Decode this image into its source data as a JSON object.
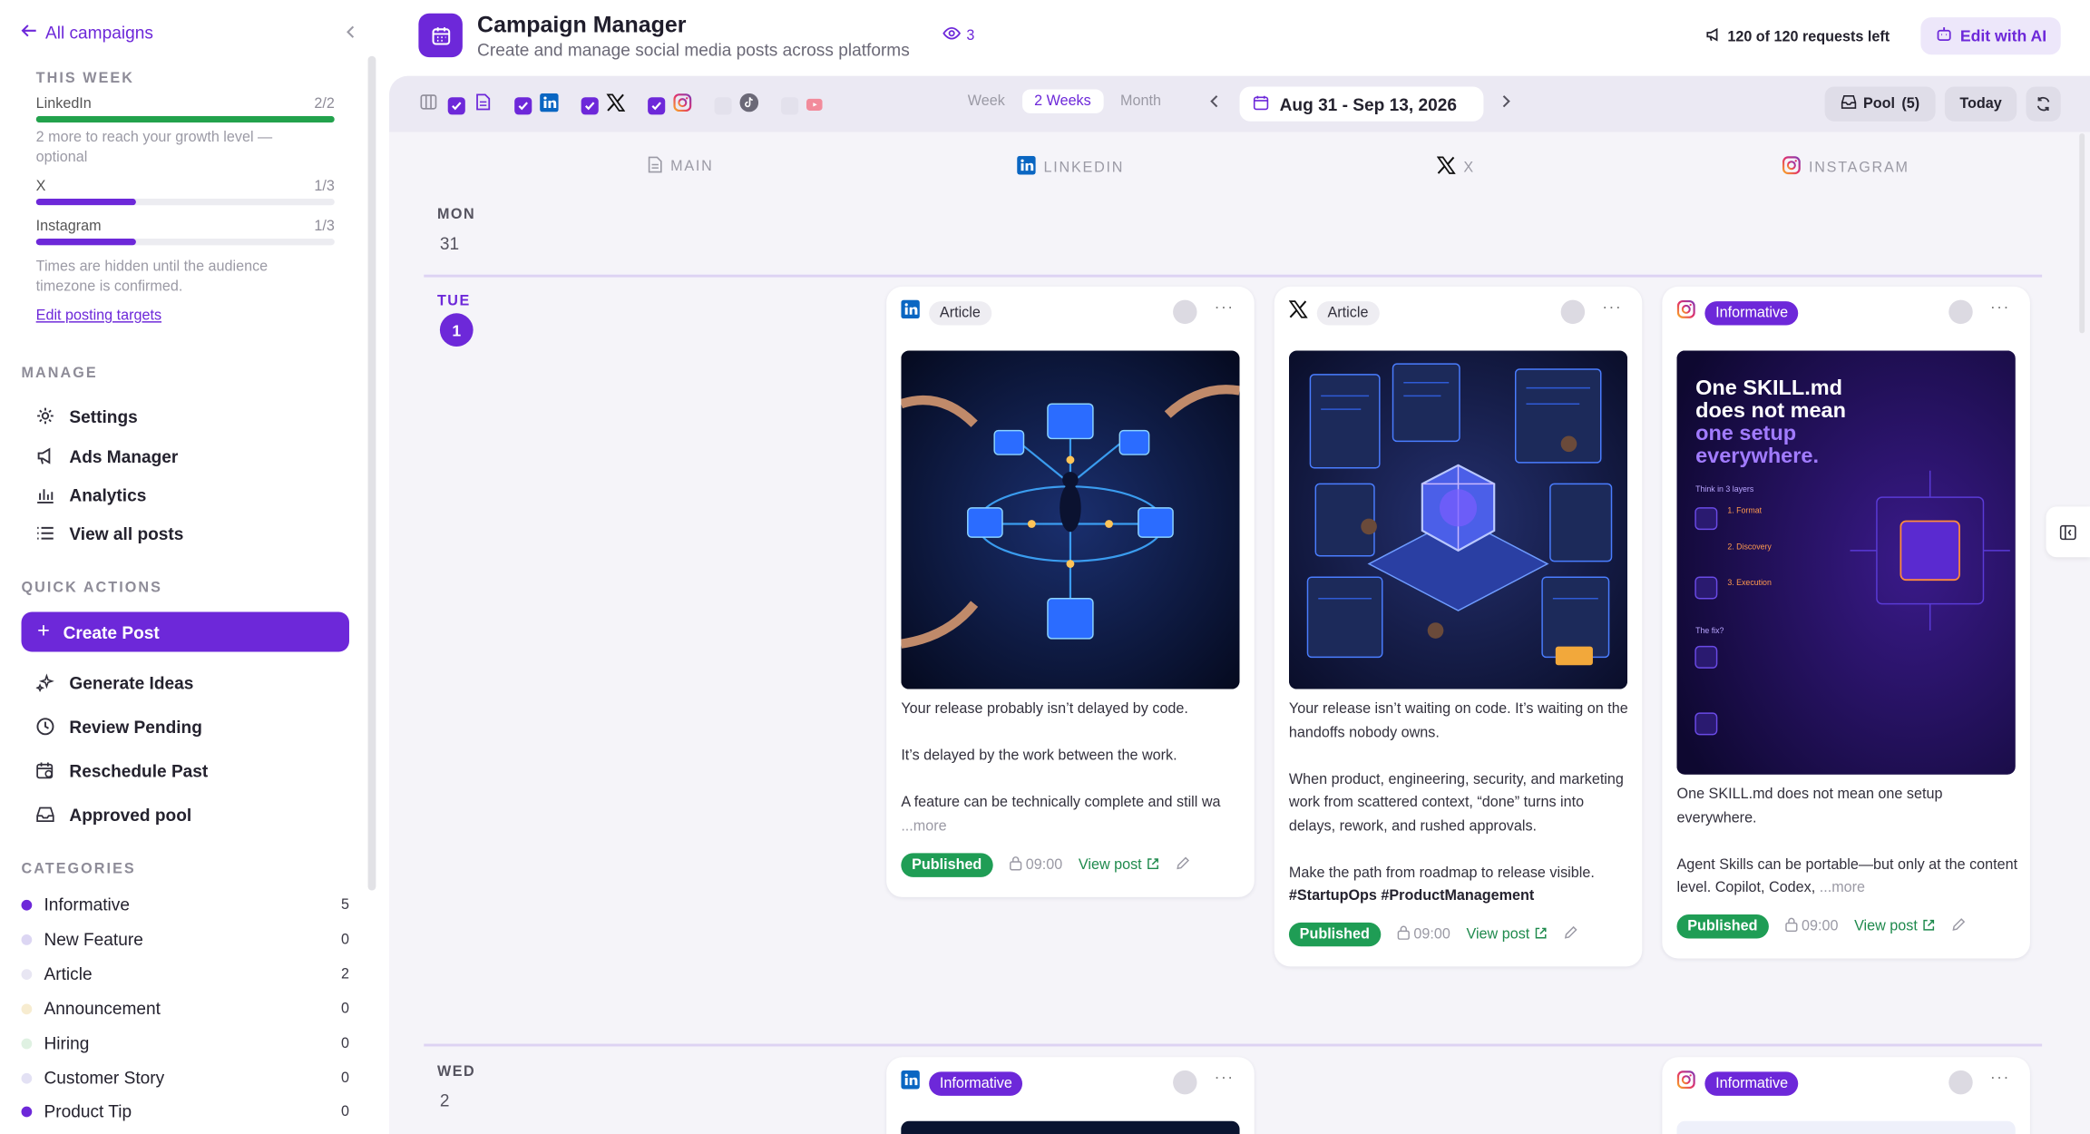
{
  "sidebar": {
    "back_label": "All campaigns",
    "this_week": {
      "title": "THIS WEEK",
      "targets": [
        {
          "name": "LinkedIn",
          "count": "2/2",
          "progress": 1.0,
          "color": "#22a24c"
        },
        {
          "name": "X",
          "count": "1/3",
          "progress": 0.333,
          "color": "#6d28d9"
        },
        {
          "name": "Instagram",
          "count": "1/3",
          "progress": 0.333,
          "color": "#6d28d9"
        }
      ],
      "linkedin_note": "2 more to reach your growth level — optional",
      "timezone_note": "Times are hidden until the audience timezone is confirmed.",
      "edit_link": "Edit posting targets"
    },
    "manage": {
      "title": "MANAGE",
      "items": [
        "Settings",
        "Ads Manager",
        "Analytics",
        "View all posts"
      ]
    },
    "quick_actions": {
      "title": "QUICK ACTIONS",
      "create": "Create Post",
      "items": [
        "Generate Ideas",
        "Review Pending",
        "Reschedule Past",
        "Approved pool"
      ]
    },
    "categories": {
      "title": "CATEGORIES",
      "items": [
        {
          "name": "Informative",
          "count": "5",
          "color": "#6d28d9"
        },
        {
          "name": "New Feature",
          "count": "0",
          "color": "#dcd6f3"
        },
        {
          "name": "Article",
          "count": "2",
          "color": "#e8e6f3"
        },
        {
          "name": "Announcement",
          "count": "0",
          "color": "#f7ecd0"
        },
        {
          "name": "Hiring",
          "count": "0",
          "color": "#dff1e2"
        },
        {
          "name": "Customer Story",
          "count": "0",
          "color": "#e3e1f4"
        },
        {
          "name": "Product Tip",
          "count": "0",
          "color": "#6d28d9"
        }
      ]
    }
  },
  "header": {
    "title": "Campaign Manager",
    "subtitle": "Create and manage social media posts across platforms",
    "views": "3",
    "requests": "120 of 120 requests left",
    "edit_ai": "Edit with AI"
  },
  "toolbar": {
    "views": [
      "Week",
      "2 Weeks",
      "Month"
    ],
    "active_view": "2 Weeks",
    "date_range": "Aug 31 - Sep 13, 2026",
    "pool": "Pool",
    "pool_count": "(5)",
    "today": "Today"
  },
  "columns": [
    "MAIN",
    "LINKEDIN",
    "X",
    "INSTAGRAM"
  ],
  "days": [
    {
      "name": "MON",
      "num": "31"
    },
    {
      "name": "TUE",
      "num": "1"
    },
    {
      "name": "WED",
      "num": "2"
    }
  ],
  "posts": [
    {
      "platform": "linkedin",
      "tag": "Article",
      "body": [
        "Your release probably isn’t delayed by code.",
        "It’s delayed by the work between the work.",
        "A feature can be technically complete and still wa"
      ],
      "more": "...more",
      "status": "Published",
      "time": "09:00",
      "view": "View post"
    },
    {
      "platform": "x",
      "tag": "Article",
      "body": [
        "Your release isn’t waiting on code. It’s waiting on the handoffs nobody owns.",
        "When product, engineering, security, and marketing work from scattered context, “done” turns into delays, rework, and rushed approvals.",
        "Make the path from roadmap to release visible."
      ],
      "hashtags": "#StartupOps #ProductManagement",
      "status": "Published",
      "time": "09:00",
      "view": "View post"
    },
    {
      "platform": "instagram",
      "tag": "Informative",
      "body": [
        "One SKILL.md does not mean one setup everywhere.",
        "Agent Skills can be portable—but only at the content level. Copilot, Codex, "
      ],
      "more": "...more",
      "image_text": {
        "headline1": "One SKILL.md",
        "headline2": "does not mean",
        "headline3": "one setup",
        "headline4": "everywhere.",
        "caption": "Think in 3 layers",
        "l1": "1. Format",
        "l2": "2. Discovery",
        "l3": "3. Execution",
        "fix": "The fix?"
      },
      "status": "Published",
      "time": "09:00",
      "view": "View post"
    }
  ],
  "wed_posts": [
    {
      "platform": "linkedin",
      "tag": "Informative"
    },
    {
      "platform": "instagram",
      "tag": "Informative"
    }
  ]
}
